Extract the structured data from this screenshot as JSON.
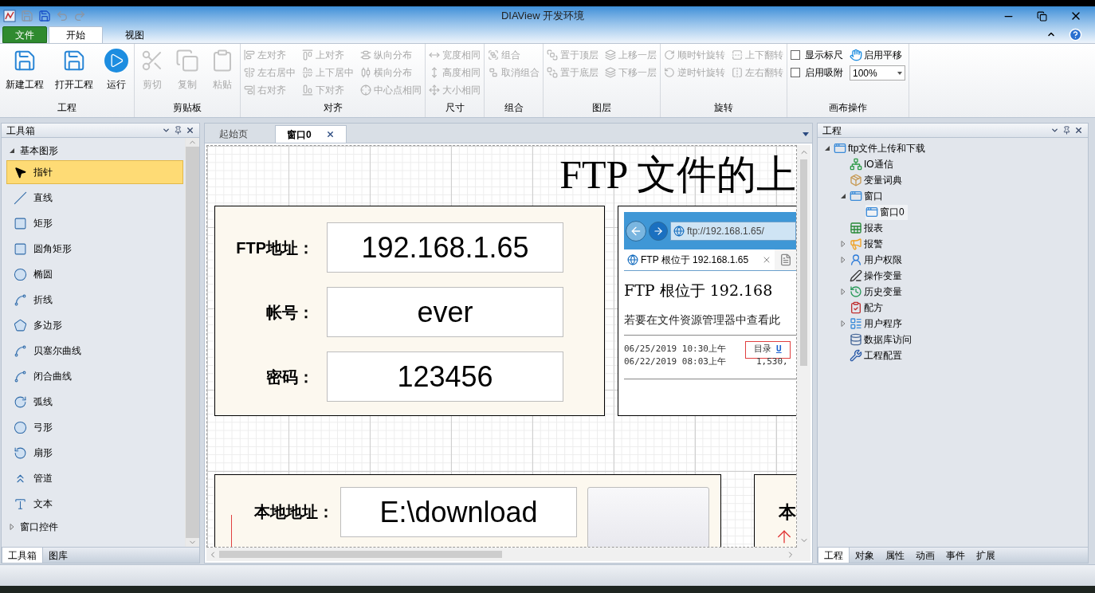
{
  "window": {
    "title": "DIAView 开发环境"
  },
  "ribbon": {
    "tabs": [
      {
        "label": "文件",
        "kind": "file",
        "selected": false
      },
      {
        "label": "开始",
        "kind": "tab",
        "selected": true
      },
      {
        "label": "视图",
        "kind": "tab",
        "selected": false
      }
    ],
    "groups": [
      {
        "label": "工程",
        "columns": [
          [
            {
              "label": "新建工程",
              "kind": "large",
              "disabled": false
            }
          ],
          [
            {
              "label": "打开工程",
              "kind": "large",
              "disabled": false
            }
          ],
          [
            {
              "label": "运行",
              "kind": "large",
              "disabled": false
            }
          ]
        ]
      },
      {
        "label": "剪贴板",
        "columns": [
          [
            {
              "label": "剪切",
              "kind": "large",
              "disabled": true
            }
          ],
          [
            {
              "label": "复制",
              "kind": "large",
              "disabled": true
            }
          ],
          [
            {
              "label": "粘贴",
              "kind": "large",
              "disabled": true
            }
          ]
        ]
      },
      {
        "label": "对齐",
        "columns": [
          [
            {
              "label": "左对齐",
              "kind": "small",
              "disabled": true
            },
            {
              "label": "左右居中",
              "kind": "small",
              "disabled": true
            },
            {
              "label": "右对齐",
              "kind": "small",
              "disabled": true
            }
          ],
          [
            {
              "label": "上对齐",
              "kind": "small",
              "disabled": true
            },
            {
              "label": "上下居中",
              "kind": "small",
              "disabled": true
            },
            {
              "label": "下对齐",
              "kind": "small",
              "disabled": true
            }
          ],
          [
            {
              "label": "纵向分布",
              "kind": "small",
              "disabled": true
            },
            {
              "label": "横向分布",
              "kind": "small",
              "disabled": true
            },
            {
              "label": "中心点相同",
              "kind": "small",
              "disabled": true
            }
          ]
        ]
      },
      {
        "label": "尺寸",
        "columns": [
          [
            {
              "label": "宽度相同",
              "kind": "small",
              "disabled": true
            },
            {
              "label": "高度相同",
              "kind": "small",
              "disabled": true
            },
            {
              "label": "大小相同",
              "kind": "small",
              "disabled": true
            }
          ]
        ]
      },
      {
        "label": "组合",
        "columns": [
          [
            {
              "label": "组合",
              "kind": "small",
              "disabled": true
            },
            {
              "label": "取消组合",
              "kind": "small",
              "disabled": true
            }
          ]
        ]
      },
      {
        "label": "图层",
        "columns": [
          [
            {
              "label": "置于顶层",
              "kind": "small",
              "disabled": true
            },
            {
              "label": "置于底层",
              "kind": "small",
              "disabled": true
            }
          ],
          [
            {
              "label": "上移一层",
              "kind": "small",
              "disabled": true
            },
            {
              "label": "下移一层",
              "kind": "small",
              "disabled": true
            }
          ]
        ]
      },
      {
        "label": "旋转",
        "columns": [
          [
            {
              "label": "顺时针旋转",
              "kind": "small",
              "disabled": true
            },
            {
              "label": "逆时针旋转",
              "kind": "small",
              "disabled": true
            }
          ],
          [
            {
              "label": "上下翻转",
              "kind": "small",
              "disabled": true
            },
            {
              "label": "左右翻转",
              "kind": "small",
              "disabled": true
            }
          ]
        ]
      },
      {
        "label": "画布操作",
        "columns": [
          [
            {
              "label": "显示标尺",
              "kind": "checkbox",
              "checked": false
            },
            {
              "label": "启用吸附",
              "kind": "checkbox",
              "checked": false
            }
          ],
          [
            {
              "label": "启用平移",
              "kind": "toggle"
            },
            {
              "label": "100%",
              "kind": "select"
            }
          ]
        ]
      }
    ]
  },
  "toolbox": {
    "title": "工具箱",
    "sections": [
      {
        "label": "基本图形",
        "expanded": true,
        "items": [
          {
            "label": "指针",
            "selected": true
          },
          {
            "label": "直线",
            "selected": false
          },
          {
            "label": "矩形",
            "selected": false
          },
          {
            "label": "圆角矩形",
            "selected": false
          },
          {
            "label": "椭圆",
            "selected": false
          },
          {
            "label": "折线",
            "selected": false
          },
          {
            "label": "多边形",
            "selected": false
          },
          {
            "label": "贝塞尔曲线",
            "selected": false
          },
          {
            "label": "闭合曲线",
            "selected": false
          },
          {
            "label": "弧线",
            "selected": false
          },
          {
            "label": "弓形",
            "selected": false
          },
          {
            "label": "扇形",
            "selected": false
          },
          {
            "label": "管道",
            "selected": false
          },
          {
            "label": "文本",
            "selected": false
          }
        ]
      },
      {
        "label": "窗口控件",
        "expanded": false
      }
    ],
    "tabs": [
      {
        "label": "工具箱",
        "selected": true
      },
      {
        "label": "图库",
        "selected": false
      }
    ]
  },
  "documents": {
    "tabs": [
      {
        "label": "起始页",
        "selected": false,
        "closable": false
      },
      {
        "label": "窗口0",
        "selected": true,
        "closable": true
      }
    ]
  },
  "canvas": {
    "title": "FTP 文件的上",
    "login_fields": [
      {
        "label": "FTP地址：",
        "value": "192.168.1.65"
      },
      {
        "label": "帐号：",
        "value": "ever"
      },
      {
        "label": "密码：",
        "value": "123456"
      }
    ],
    "browser_snapshot": {
      "address": "ftp://192.168.1.65/",
      "tab": "FTP 根位于 192.168.1.65",
      "heading": "FTP 根位于 192.168",
      "note": "若要在文件资源管理器中查看此",
      "listing": [
        {
          "kind": "dir",
          "date": "06/25/2019 10:30上午",
          "info": "目录",
          "link": "U"
        },
        {
          "kind": "file",
          "date": "06/22/2019 08:03上午",
          "info": "1,530,"
        }
      ]
    },
    "local_field": {
      "label": "本地地址：",
      "value": "E:\\download"
    },
    "side_card": {
      "label": "本"
    }
  },
  "project": {
    "title": "工程",
    "tree": [
      {
        "label": "ftp文件上传和下载",
        "expanded": true,
        "selected": false,
        "children": [
          {
            "label": "IO通信",
            "selected": false
          },
          {
            "label": "变量词典",
            "selected": false
          },
          {
            "label": "窗口",
            "expanded": true,
            "selected": false,
            "children": [
              {
                "label": "窗口0",
                "selected": true
              }
            ]
          },
          {
            "label": "报表",
            "selected": false
          },
          {
            "label": "报警",
            "expanded": false,
            "selected": false
          },
          {
            "label": "用户权限",
            "expanded": false,
            "selected": false
          },
          {
            "label": "操作变量",
            "selected": false
          },
          {
            "label": "历史变量",
            "expanded": false,
            "selected": false
          },
          {
            "label": "配方",
            "selected": false
          },
          {
            "label": "用户程序",
            "expanded": false,
            "selected": false
          },
          {
            "label": "数据库访问",
            "selected": false
          },
          {
            "label": "工程配置",
            "selected": false
          }
        ]
      }
    ],
    "tabs": [
      {
        "label": "工程",
        "selected": true
      },
      {
        "label": "对象",
        "selected": false
      },
      {
        "label": "属性",
        "selected": false
      },
      {
        "label": "动画",
        "selected": false
      },
      {
        "label": "事件",
        "selected": false
      },
      {
        "label": "扩展",
        "selected": false
      }
    ]
  }
}
